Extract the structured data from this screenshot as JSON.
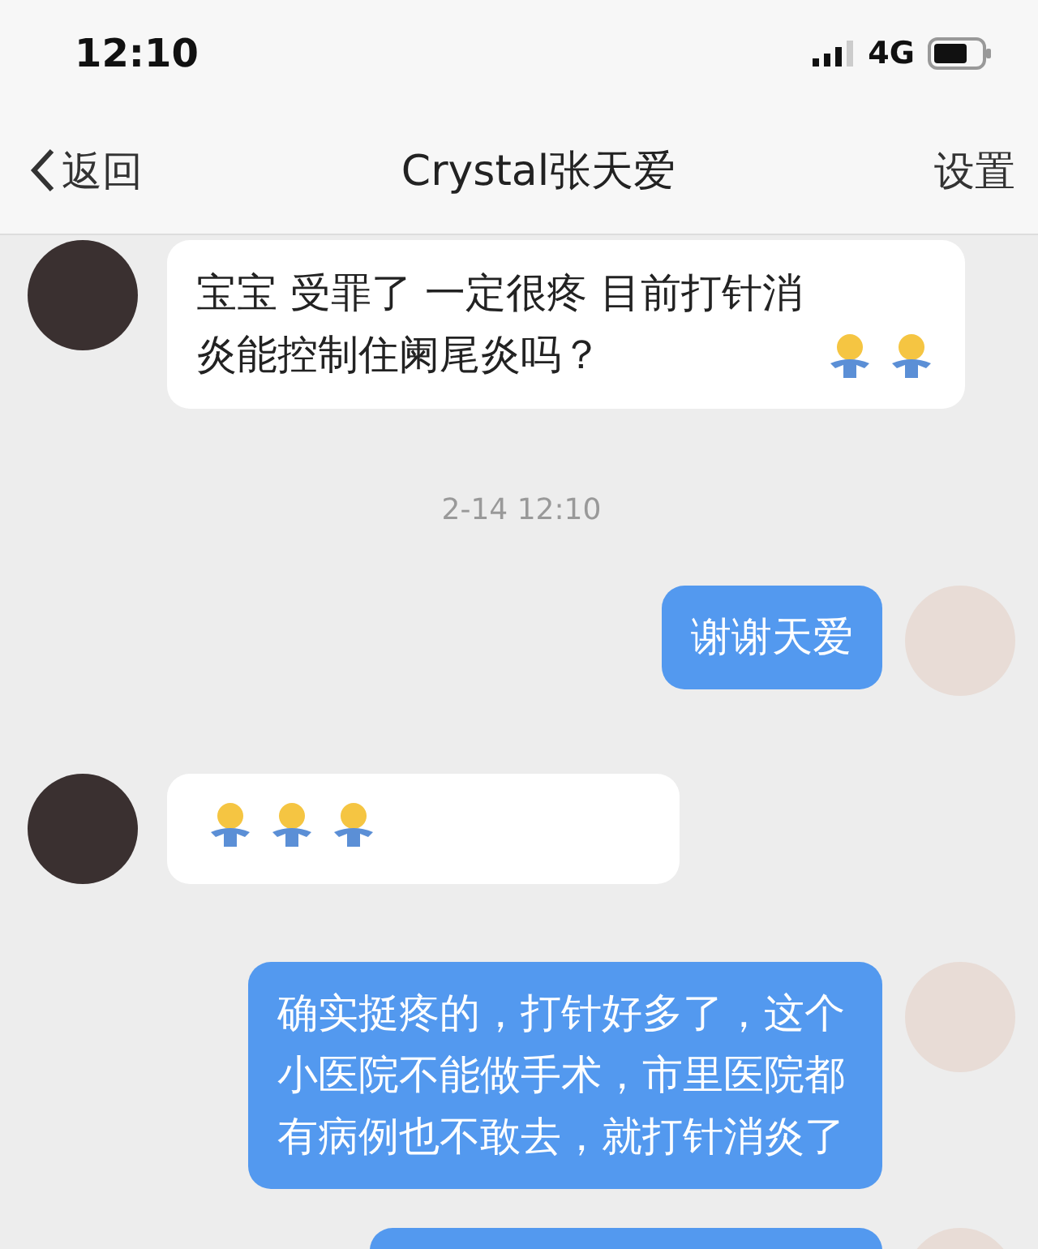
{
  "status_bar": {
    "time": "12:10",
    "network": "4G"
  },
  "nav": {
    "back": "返回",
    "title": "Crystal张天爱",
    "settings": "设置"
  },
  "messages": [
    {
      "kind": "in",
      "text": "宝宝 受罪了 一定很疼 目前打针消炎能控制住阑尾炎吗？",
      "emojis": [
        {
          "kind": "hug"
        },
        {
          "kind": "hug"
        }
      ]
    },
    {
      "kind": "time",
      "text": "2-14 12:10"
    },
    {
      "kind": "out",
      "text": "谢谢天爱"
    },
    {
      "kind": "in",
      "emojis": [
        {
          "kind": "hug"
        },
        {
          "kind": "hug"
        },
        {
          "kind": "hug"
        }
      ]
    },
    {
      "kind": "out",
      "text": "确实挺疼的，打针好多了，这个小医院不能做手术，市里医院都有病例也不敢去，就打针消炎了"
    },
    {
      "kind": "out"
    }
  ]
}
